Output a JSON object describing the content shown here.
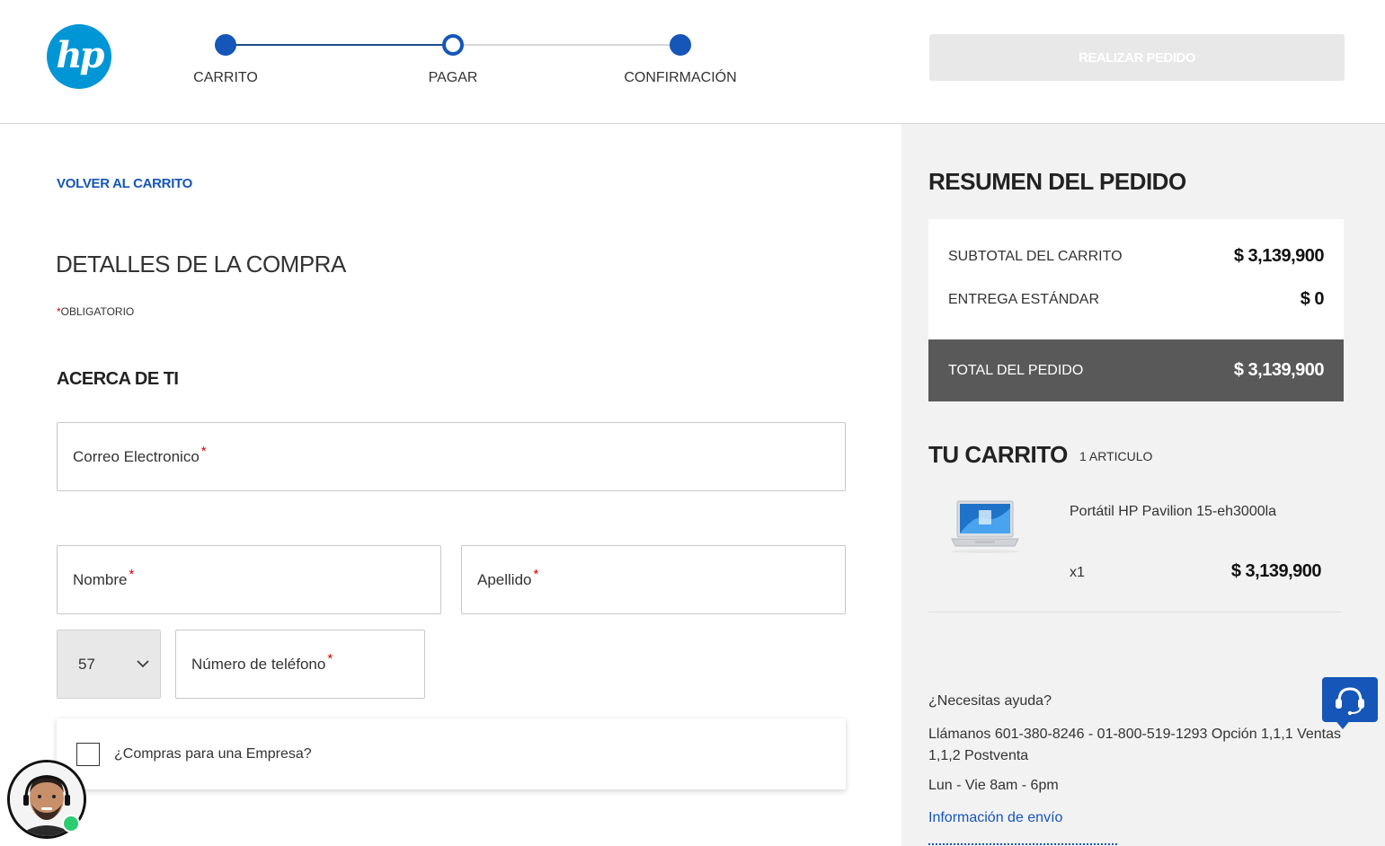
{
  "brand": {
    "logo_text": "hp",
    "color": "#0096d6"
  },
  "stepper": {
    "steps": [
      {
        "label": "CARRITO",
        "state": "done"
      },
      {
        "label": "PAGAR",
        "state": "current"
      },
      {
        "label": "CONFIRMACIÓN",
        "state": "todo"
      }
    ],
    "accent": "#1556b8"
  },
  "header": {
    "place_order_label": "REALIZAR PEDIDO"
  },
  "checkout": {
    "back_link": "VOLVER AL CARRITO",
    "title": "DETALLES DE LA COMPRA",
    "required_mark": "*",
    "required_note": "OBLIGATORIO",
    "section_about": "ACERCA DE TI",
    "fields": {
      "email": "Correo Electronico",
      "first_name": "Nombre",
      "last_name": "Apellido",
      "country_code": "57",
      "phone": "Número de teléfono"
    },
    "company_checkbox": "¿Compras para una Empresa?"
  },
  "summary": {
    "title": "RESUMEN DEL PEDIDO",
    "subtotal_label": "SUBTOTAL DEL CARRITO",
    "subtotal_value": "$ 3,139,900",
    "shipping_label": "ENTREGA ESTÁNDAR",
    "shipping_value": "$ 0",
    "total_label": "TOTAL DEL PEDIDO",
    "total_value": "$ 3,139,900"
  },
  "cart": {
    "title": "TU CARRITO",
    "count": "1 ARTICULO",
    "items": [
      {
        "name": "Portátil HP Pavilion 15-eh3000la",
        "qty": "x1",
        "price": "$ 3,139,900"
      }
    ]
  },
  "help": {
    "title": "¿Necesitas ayuda?",
    "phone": "Llámanos 601-380-8246 - 01-800-519-1293 Opción 1,1,1 Ventas 1,1,2 Postventa",
    "hours": "Lun - Vie 8am - 6pm",
    "shipping_link": "Información de envío"
  },
  "icons": {
    "chat": "chat-support-icon",
    "chevron": "chevron-down-icon",
    "agent": "agent-avatar"
  }
}
